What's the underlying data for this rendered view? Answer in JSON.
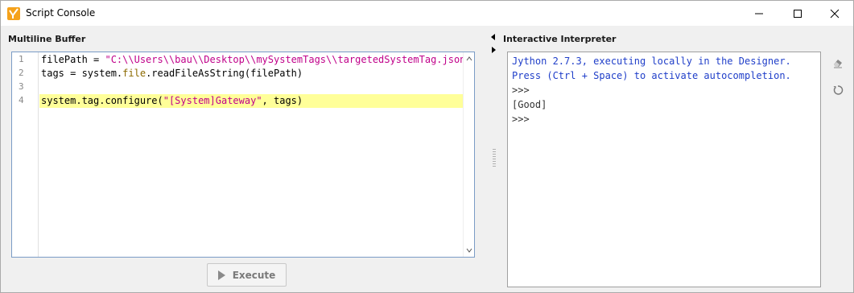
{
  "window": {
    "title": "Script Console",
    "controls": [
      "minimize",
      "maximize",
      "close"
    ]
  },
  "left_pane": {
    "heading": "Multiline Buffer",
    "line_numbers": [
      "1",
      "2",
      "3",
      "4"
    ],
    "code": {
      "line1_pre": "filePath = ",
      "line1_str": "\"C:\\\\Users\\\\bau\\\\Desktop\\\\mySystemTags\\\\targetedSystemTag.json\"",
      "line2_pre": "tags = system.",
      "line2_attr": "file",
      "line2_post": ".readFileAsString(filePath)",
      "line3": "",
      "line4_pre": "system.tag.configure(",
      "line4_str": "\"[System]Gateway\"",
      "line4_post": ", tags)"
    },
    "highlighted_line": 4,
    "execute_label": "Execute"
  },
  "right_pane": {
    "heading": "Interactive Interpreter",
    "console": {
      "intro1": "Jython 2.7.3, executing locally in the Designer.",
      "intro2": "Press (Ctrl + Space) to activate autocompletion.",
      "prompt1": ">>>",
      "output": "[Good]",
      "prompt2": ">>>"
    },
    "tools": [
      "eraser-icon",
      "reset-icon"
    ]
  },
  "colors": {
    "string": "#c0008a",
    "attribute": "#8c6a00",
    "console_text": "#1f3ec9",
    "line_highlight": "#ffff99",
    "app_icon": "#f5a21b"
  }
}
